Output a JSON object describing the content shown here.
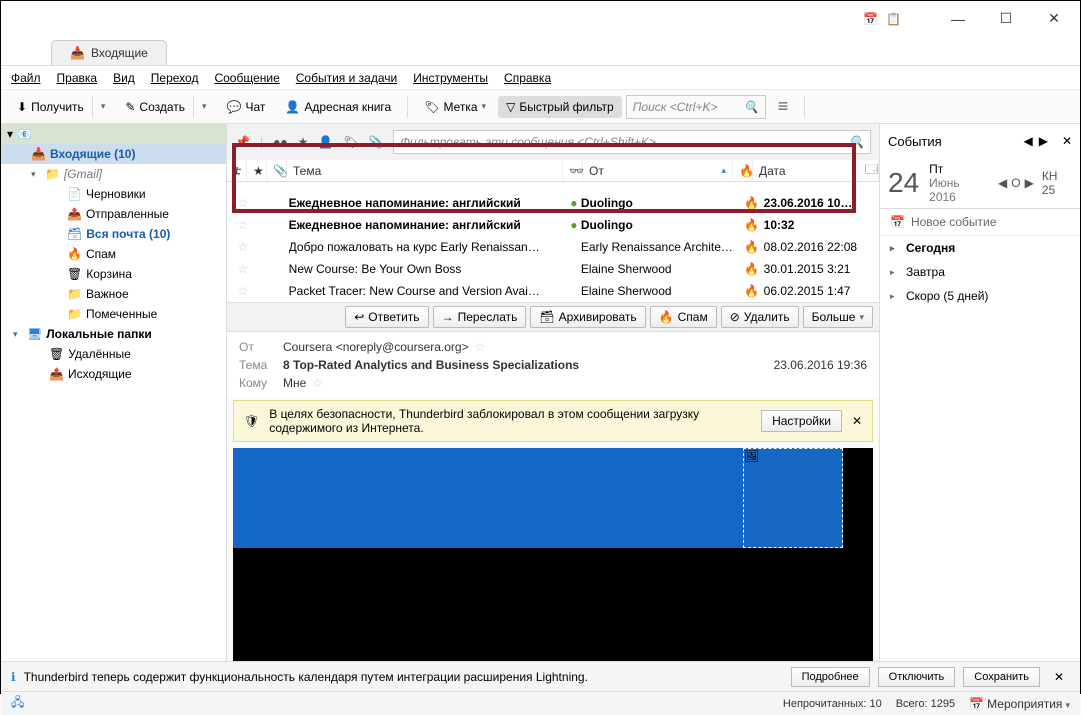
{
  "window": {
    "title": "Входящие"
  },
  "titleicons": {
    "cal1": "📅",
    "cal2": "📋"
  },
  "menu": {
    "file": "Файл",
    "edit": "Правка",
    "view": "Вид",
    "go": "Переход",
    "message": "Сообщение",
    "events": "События и задачи",
    "tools": "Инструменты",
    "help": "Справка"
  },
  "toolbar": {
    "get": "Получить",
    "create": "Создать",
    "chat": "Чат",
    "address": "Адресная книга",
    "tag": "Метка",
    "quickfilter": "Быстрый фильтр",
    "search_ph": "Поиск <Ctrl+K>",
    "events": "События"
  },
  "folders": {
    "inbox": "Входящие (10)",
    "gmail": "[Gmail]",
    "drafts": "Черновики",
    "sent": "Отправленные",
    "allmail": "Вся почта (10)",
    "spam": "Спам",
    "trash": "Корзина",
    "important": "Важное",
    "starred": "Помеченные",
    "local": "Локальные папки",
    "deleted": "Удалённые",
    "outgoing": "Исходящие"
  },
  "quickfilter": {
    "placeholder": "Фильтровать эти сообщения <Ctrl+Shift+K>"
  },
  "columns": {
    "subject": "Тема",
    "from": "От",
    "date": "Дата"
  },
  "messages": [
    {
      "subject": "Ежедневное напоминание: английский",
      "from": "Duolingo",
      "date": "23.06.2016 10…",
      "bold": true,
      "green": true
    },
    {
      "subject": "Ежедневное напоминание: английский",
      "from": "Duolingo",
      "date": "10:32",
      "bold": true,
      "green": true
    },
    {
      "subject": "Добро пожаловать на курс Early Renaissan…",
      "from": "Early Renaissance Archite…",
      "date": "08.02.2016 22:08"
    },
    {
      "subject": "New Course: Be Your Own Boss",
      "from": "Elaine Sherwood",
      "date": "30.01.2015 3:21"
    },
    {
      "subject": "Packet Tracer: New Course and Version Avai…",
      "from": "Elaine Sherwood",
      "date": "06.02.2015 1:47"
    }
  ],
  "msgtoolbar": {
    "reply": "Ответить",
    "forward": "Переслать",
    "archive": "Архивировать",
    "spam": "Спам",
    "delete": "Удалить",
    "more": "Больше"
  },
  "msgheader": {
    "from_lbl": "От",
    "from_val": "Coursera <noreply@coursera.org>",
    "subj_lbl": "Тема",
    "subj_val": "8 Top-Rated Analytics and Business Specializations",
    "to_lbl": "Кому",
    "to_val": "Мне",
    "date": "23.06.2016 19:36"
  },
  "blocked": {
    "text": "В целях безопасности, Thunderbird заблокировал в этом сообщении загрузку содержимого из Интернета.",
    "settings": "Настройки"
  },
  "calendar": {
    "events": "События",
    "day": "24",
    "weekday": "Пт",
    "month": "Июнь 2016",
    "weeklabel": "КН 25",
    "nav_o": "O",
    "newevent": "Новое событие",
    "today": "Сегодня",
    "tomorrow": "Завтра",
    "soon": "Скоро (5 дней)"
  },
  "notif": {
    "text": "Thunderbird теперь содержит функциональность календаря путем интеграции расширения Lightning.",
    "more": "Подробнее",
    "disable": "Отключить",
    "save": "Сохранить"
  },
  "status": {
    "unread": "Непрочитанных: 10",
    "total": "Всего: 1295",
    "events": "Мероприятия"
  }
}
